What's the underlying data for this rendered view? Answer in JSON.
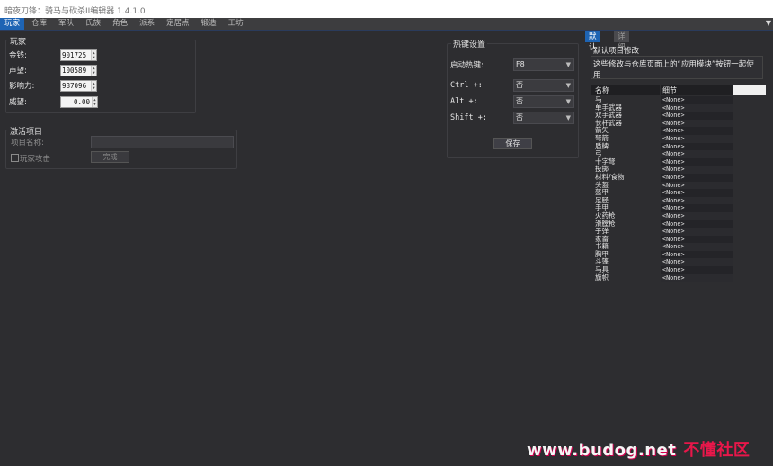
{
  "window": {
    "title": "暗夜刀锋：骑马与砍杀II编辑器 1.4.1.0"
  },
  "menu": {
    "items": [
      "玩家",
      "仓库",
      "军队",
      "氏族",
      "角色",
      "派系",
      "定居点",
      "锻造",
      "工坊"
    ],
    "active": "玩家",
    "overflow_icon": "chevron-down-icon"
  },
  "player": {
    "group_title": "玩家",
    "gold_label": "金钱:",
    "gold_value": "901725",
    "renown_label": "声望:",
    "renown_value": "100589",
    "influence_label": "影响力:",
    "influence_value": "987096",
    "prestige_label": "威望:",
    "prestige_value": "0.00"
  },
  "activate": {
    "group_title": "激活项目",
    "project_name_label": "项目名称:",
    "project_name_value": "",
    "player_attack_label": "玩家攻击",
    "player_attack_checked": false,
    "done_button": "完成"
  },
  "hotkeys": {
    "group_title": "热键设置",
    "start_label": "启动热键:",
    "start_value": "F8",
    "ctrl_label": "Ctrl +:",
    "ctrl_value": "否",
    "alt_label": "Alt +:",
    "alt_value": "否",
    "shift_label": "Shift +:",
    "shift_value": "否",
    "save_button": "保存"
  },
  "right_panel": {
    "tabs": [
      {
        "label": "默认",
        "active": true
      },
      {
        "label": "详细",
        "active": false
      }
    ],
    "heading": "默认项目修改",
    "description": "这些修改与仓库页面上的“应用模块”按钮一起使用",
    "grid": {
      "columns": [
        "名称",
        "细节"
      ],
      "rows": [
        {
          "name": "马",
          "detail": "<None>"
        },
        {
          "name": "单手武器",
          "detail": "<None>"
        },
        {
          "name": "双手武器",
          "detail": "<None>"
        },
        {
          "name": "长杆武器",
          "detail": "<None>"
        },
        {
          "name": "箭矢",
          "detail": "<None>"
        },
        {
          "name": "弩箭",
          "detail": "<None>"
        },
        {
          "name": "盾牌",
          "detail": "<None>"
        },
        {
          "name": "弓",
          "detail": "<None>"
        },
        {
          "name": "十字弩",
          "detail": "<None>"
        },
        {
          "name": "投掷",
          "detail": "<None>"
        },
        {
          "name": "材料/食物",
          "detail": "<None>"
        },
        {
          "name": "头盔",
          "detail": "<None>"
        },
        {
          "name": "盔甲",
          "detail": "<None>"
        },
        {
          "name": "足胫",
          "detail": "<None>"
        },
        {
          "name": "手甲",
          "detail": "<None>"
        },
        {
          "name": "火药枪",
          "detail": "<None>"
        },
        {
          "name": "滑膛枪",
          "detail": "<None>"
        },
        {
          "name": "子弹",
          "detail": "<None>"
        },
        {
          "name": "家畜",
          "detail": "<None>"
        },
        {
          "name": "书籍",
          "detail": "<None>"
        },
        {
          "name": "胸甲",
          "detail": "<None>"
        },
        {
          "name": "斗篷",
          "detail": "<None>"
        },
        {
          "name": "马具",
          "detail": "<None>"
        },
        {
          "name": "旗帜",
          "detail": "<None>"
        }
      ]
    }
  },
  "watermark": {
    "url": "www.budog.net",
    "name": "不懂社区"
  }
}
